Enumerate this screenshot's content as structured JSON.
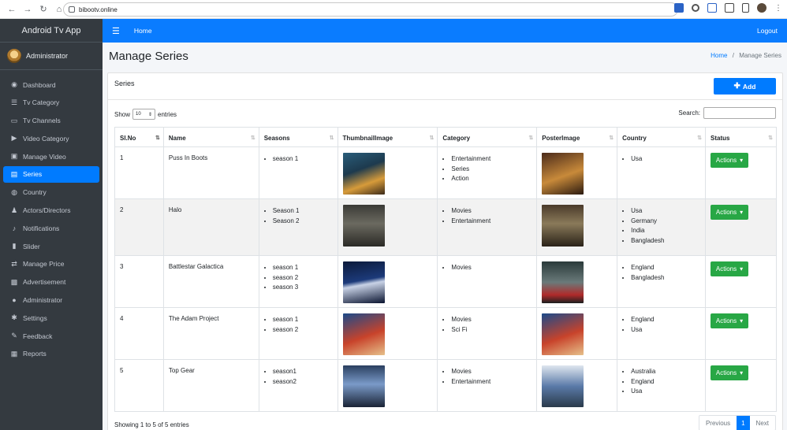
{
  "browser": {
    "url": "bibootv.online"
  },
  "sidebar": {
    "brand": "Android Tv App",
    "user": "Administrator",
    "items": [
      {
        "label": "Dashboard",
        "icon": "dashboard-icon",
        "glyph": "◉"
      },
      {
        "label": "Tv Category",
        "icon": "list-icon",
        "glyph": "☰"
      },
      {
        "label": "Tv Channels",
        "icon": "tv-icon",
        "glyph": "▭"
      },
      {
        "label": "Video Category",
        "icon": "video-icon",
        "glyph": "▶"
      },
      {
        "label": "Manage Video",
        "icon": "image-icon",
        "glyph": "▣"
      },
      {
        "label": "Series",
        "icon": "series-icon",
        "glyph": "▤"
      },
      {
        "label": "Country",
        "icon": "globe-icon",
        "glyph": "◍"
      },
      {
        "label": "Actors/Directors",
        "icon": "users-icon",
        "glyph": "♟"
      },
      {
        "label": "Notifications",
        "icon": "bell-icon",
        "glyph": "♪"
      },
      {
        "label": "Slider",
        "icon": "slider-icon",
        "glyph": "▮"
      },
      {
        "label": "Manage Price",
        "icon": "price-icon",
        "glyph": "⇄"
      },
      {
        "label": "Advertisement",
        "icon": "ad-icon",
        "glyph": "▩"
      },
      {
        "label": "Administrator",
        "icon": "user-icon",
        "glyph": "●"
      },
      {
        "label": "Settings",
        "icon": "gear-icon",
        "glyph": "✱"
      },
      {
        "label": "Feedback",
        "icon": "feedback-icon",
        "glyph": "✎"
      },
      {
        "label": "Reports",
        "icon": "report-icon",
        "glyph": "▦"
      }
    ],
    "active_index": 5
  },
  "topnav": {
    "home": "Home",
    "logout": "Logout"
  },
  "header": {
    "title": "Manage Series",
    "breadcrumb_home": "Home",
    "breadcrumb_sep": "/",
    "breadcrumb_current": "Manage Series"
  },
  "card": {
    "title": "Series",
    "add_label": "Add",
    "show_label": "Show",
    "entries_value": "10",
    "entries_label": "entries",
    "search_label": "Search:",
    "columns": [
      "Sl.No",
      "Name",
      "Seasons",
      "ThumbnailImage",
      "Category",
      "PosterImage",
      "Country",
      "Status"
    ],
    "rows": [
      {
        "no": "1",
        "name": "Puss In Boots",
        "seasons": [
          "season 1"
        ],
        "category": [
          "Entertainment",
          "Series",
          "Action"
        ],
        "country": [
          "Usa"
        ],
        "action": "Actions"
      },
      {
        "no": "2",
        "name": "Halo",
        "seasons": [
          "Season 1",
          "Season 2"
        ],
        "category": [
          "Movies",
          "Entertainment"
        ],
        "country": [
          "Usa",
          "Germany",
          "India",
          "Bangladesh"
        ],
        "action": "Actions"
      },
      {
        "no": "3",
        "name": "Battlestar Galactica",
        "seasons": [
          "season 1",
          "season 2",
          "season 3"
        ],
        "category": [
          "Movies"
        ],
        "country": [
          "England",
          "Bangladesh"
        ],
        "action": "Actions"
      },
      {
        "no": "4",
        "name": "The Adam Project",
        "seasons": [
          "season 1",
          "season 2"
        ],
        "category": [
          "Movies",
          "Sci Fi"
        ],
        "country": [
          "England",
          "Usa"
        ],
        "action": "Actions"
      },
      {
        "no": "5",
        "name": "Top Gear",
        "seasons": [
          "season1",
          "season2"
        ],
        "category": [
          "Movies",
          "Entertainment"
        ],
        "country": [
          "Australia",
          "England",
          "Usa"
        ],
        "action": "Actions"
      }
    ],
    "footer": "Showing 1 to 5 of 5 entries",
    "pager": {
      "prev": "Previous",
      "current": "1",
      "next": "Next"
    }
  },
  "colors": {
    "primary": "#007bff",
    "success": "#28a745",
    "sidebar": "#343a40"
  }
}
